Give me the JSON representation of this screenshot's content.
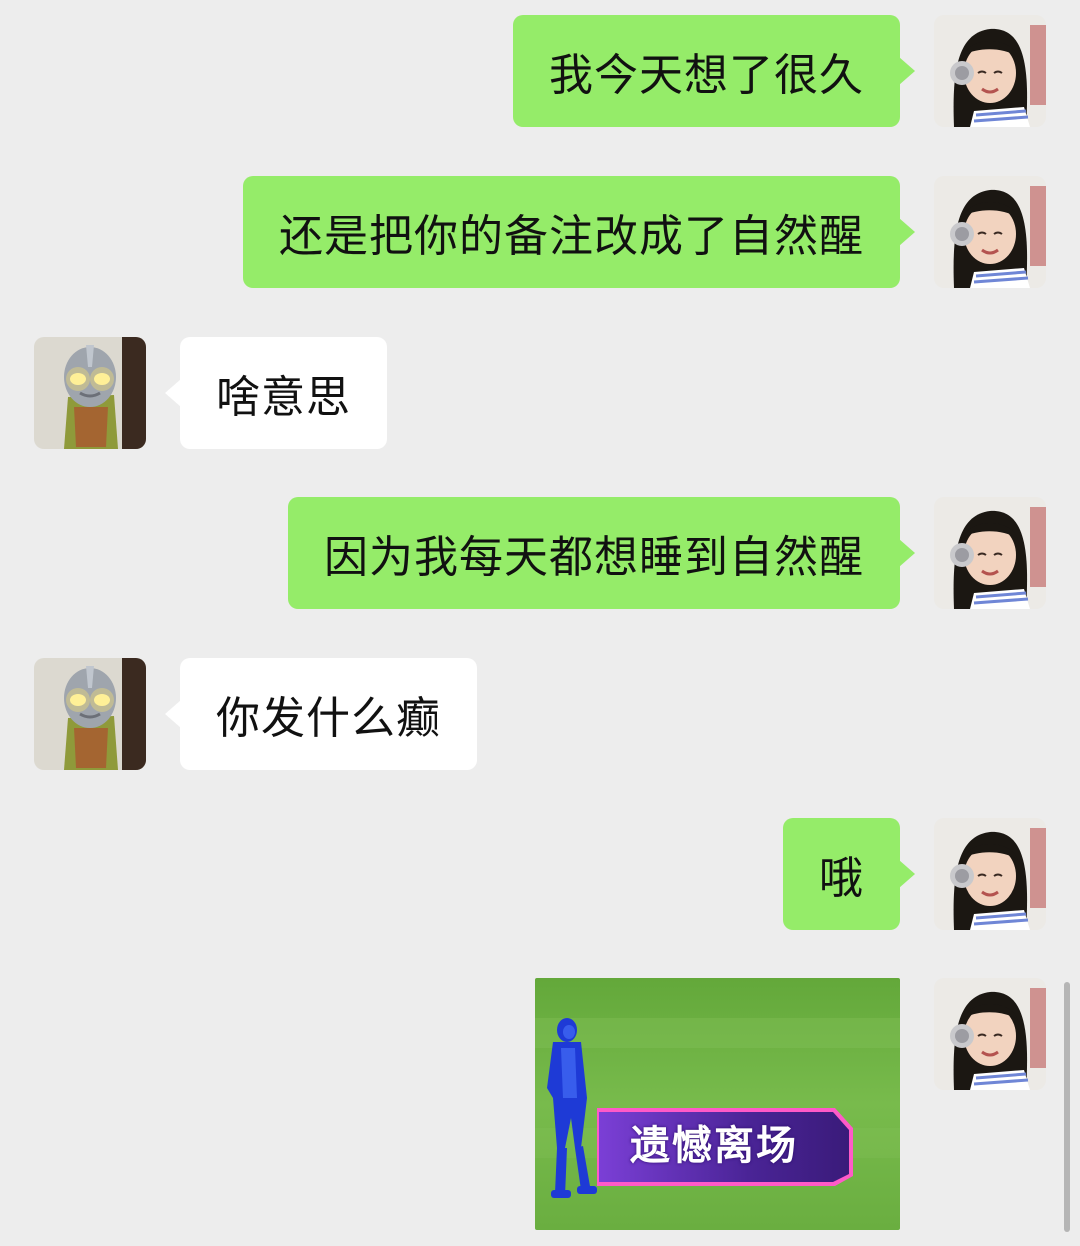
{
  "messages": [
    {
      "side": "me",
      "text": "我今天想了很久"
    },
    {
      "side": "me",
      "text": "还是把你的备注改成了自然醒"
    },
    {
      "side": "them",
      "text": "啥意思"
    },
    {
      "side": "me",
      "text": "因为我每天都想睡到自然醒"
    },
    {
      "side": "them",
      "text": "你发什么癫"
    },
    {
      "side": "me",
      "text": "哦"
    }
  ],
  "sticker": {
    "caption": "遗憾离场",
    "background_color": "#6fb442",
    "banner_color": "#5a2bb8"
  },
  "colors": {
    "chat_background": "#ededed",
    "my_bubble": "#95ec69",
    "their_bubble": "#ffffff"
  }
}
